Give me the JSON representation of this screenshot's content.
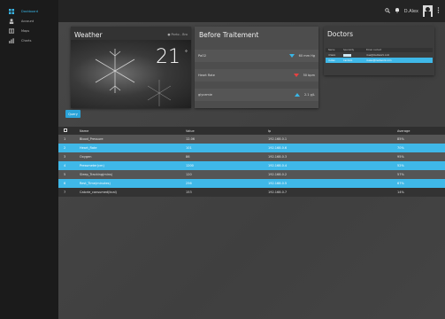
{
  "sidebar": {
    "items": [
      {
        "label": "Dashboard",
        "icon": "grid-icon",
        "active": true
      },
      {
        "label": "Account",
        "icon": "person-icon",
        "active": false
      },
      {
        "label": "Maps",
        "icon": "map-icon",
        "active": false
      },
      {
        "label": "Charts",
        "icon": "chart-icon",
        "active": false
      }
    ]
  },
  "topbar": {
    "search_icon": "search-icon",
    "bell_icon": "bell-icon",
    "user_name": "D.Alex",
    "more_icon": "more-vert-icon"
  },
  "weather": {
    "title": "Weather",
    "location": "Porto - Bro",
    "temperature": "21",
    "unit": "°"
  },
  "before": {
    "title": "Before Traitement",
    "metrics": [
      {
        "label": "PaO2",
        "value": "60 mm Hg",
        "trend": "down",
        "color": "#39b6e6"
      },
      {
        "label": "Heart Rate",
        "value": "50 bpm",
        "trend": "down",
        "color": "#e64141"
      },
      {
        "label": "glycemie",
        "value": "2.1 g/L",
        "trend": "up",
        "color": "#39b6e6"
      }
    ]
  },
  "doctors": {
    "title": "Doctors",
    "columns": [
      "Name",
      "Speciality",
      "Email contact"
    ],
    "rows": [
      {
        "name": "d.Sara",
        "speciality": "",
        "email": "d.sa@mediwork.com"
      },
      {
        "name": "d.Alex",
        "speciality": "Cardiolo",
        "email": "d.alex@mediwork.com"
      }
    ]
  },
  "query_button": "Query",
  "table": {
    "columns": [
      "Name",
      "Value",
      "Ip",
      "Average"
    ],
    "rows": [
      {
        "n": "1",
        "name": "Blood_Pressure",
        "value": "12.06",
        "ip": "192.168.0.1",
        "avg": "85%"
      },
      {
        "n": "2",
        "name": "Heart_Rate",
        "value": "101",
        "ip": "192.168.0.6",
        "avg": "70%"
      },
      {
        "n": "3",
        "name": "Oxygen",
        "value": "86",
        "ip": "192.168.0.3",
        "avg": "95%"
      },
      {
        "n": "4",
        "name": "Pressmeter(cm)",
        "value": "1200",
        "ip": "192.168.0.4",
        "avg": "52%"
      },
      {
        "n": "5",
        "name": "Sleep_Tracking(mins)",
        "value": "120",
        "ip": "192.168.0.2",
        "avg": "57%"
      },
      {
        "n": "6",
        "name": "Rest_Time(minutes)",
        "value": "256",
        "ip": "192.168.0.5",
        "avg": "67%"
      },
      {
        "n": "7",
        "name": "Calorie_consumed(kcal)",
        "value": "153",
        "ip": "192.168.0.7",
        "avg": "14%"
      }
    ]
  },
  "colors": {
    "accent": "#3fb8e8",
    "sidebar": "#1b1b1b",
    "background": "#434343"
  }
}
